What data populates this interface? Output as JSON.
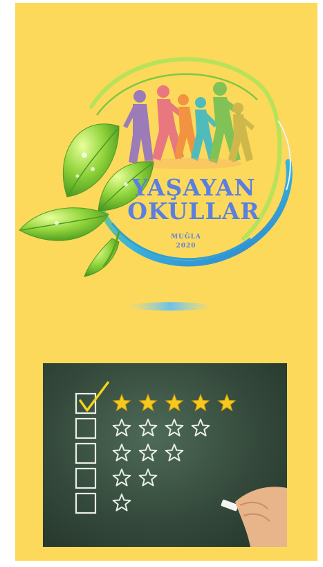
{
  "logo": {
    "line1": "YAŞAYAN",
    "line2": "OKULLAR",
    "city": "MUĞLA",
    "year": "2020",
    "title_color": "#5a7fe0",
    "ring_colors": [
      "#7ec843",
      "#2e9fd6"
    ]
  },
  "rating_board": {
    "rows": [
      {
        "stars": 5,
        "checked": true
      },
      {
        "stars": 4,
        "checked": false
      },
      {
        "stars": 3,
        "checked": false
      },
      {
        "stars": 2,
        "checked": false
      },
      {
        "stars": 1,
        "checked": false
      }
    ],
    "filled_star_color": "#f7c81e",
    "check_color": "#f3d21a",
    "chalk_color": "#e9efe8"
  }
}
